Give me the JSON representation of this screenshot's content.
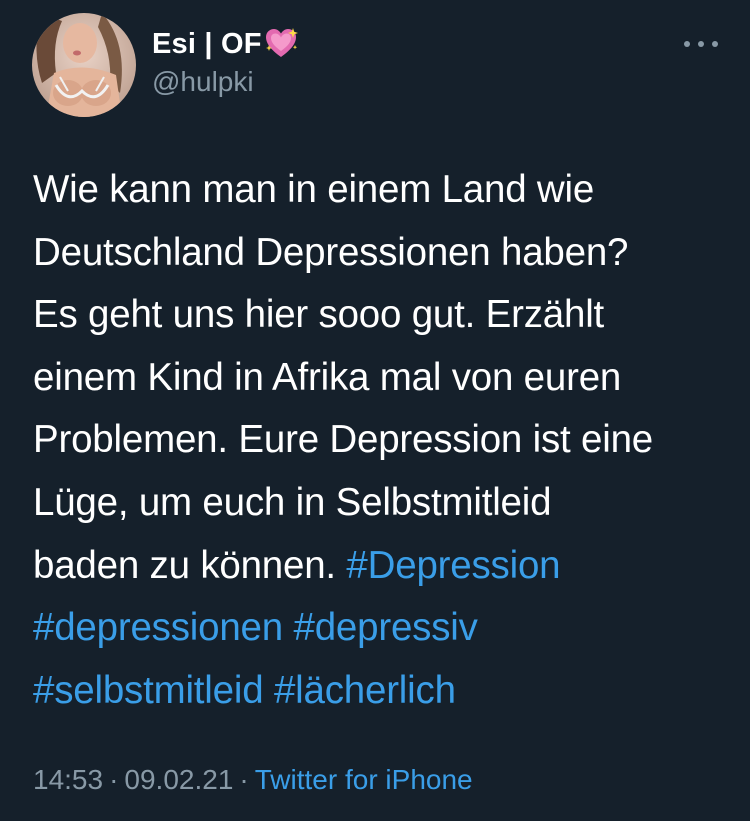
{
  "author": {
    "display_name": "Esi | OF",
    "handle": "@hulpki",
    "badge_icon": "sparkling-heart-icon"
  },
  "tweet": {
    "lines": [
      {
        "text": "Wie kann man in einem Land wie"
      },
      {
        "text": "Deutschland Depressionen haben?"
      },
      {
        "text": "Es geht uns hier sooo gut. Erzählt"
      },
      {
        "text": "einem Kind in Afrika mal von euren"
      },
      {
        "text": "Problemen. Eure Depression ist eine"
      },
      {
        "text": "Lüge, um euch in Selbstmitleid"
      },
      {
        "text": "baden zu können. ",
        "hashtag": "#Depression"
      }
    ],
    "hashtags_line_2": [
      "#depressionen",
      "#depressiv"
    ],
    "hashtags_line_3": [
      "#selbstmitleid",
      "#lächerlich"
    ]
  },
  "meta": {
    "time": "14:53",
    "date": "09.02.21",
    "separator": "·",
    "source": "Twitter for iPhone"
  },
  "colors": {
    "background": "#15202b",
    "text": "#ffffff",
    "secondary": "#8899a6",
    "link": "#3a9ee8"
  }
}
